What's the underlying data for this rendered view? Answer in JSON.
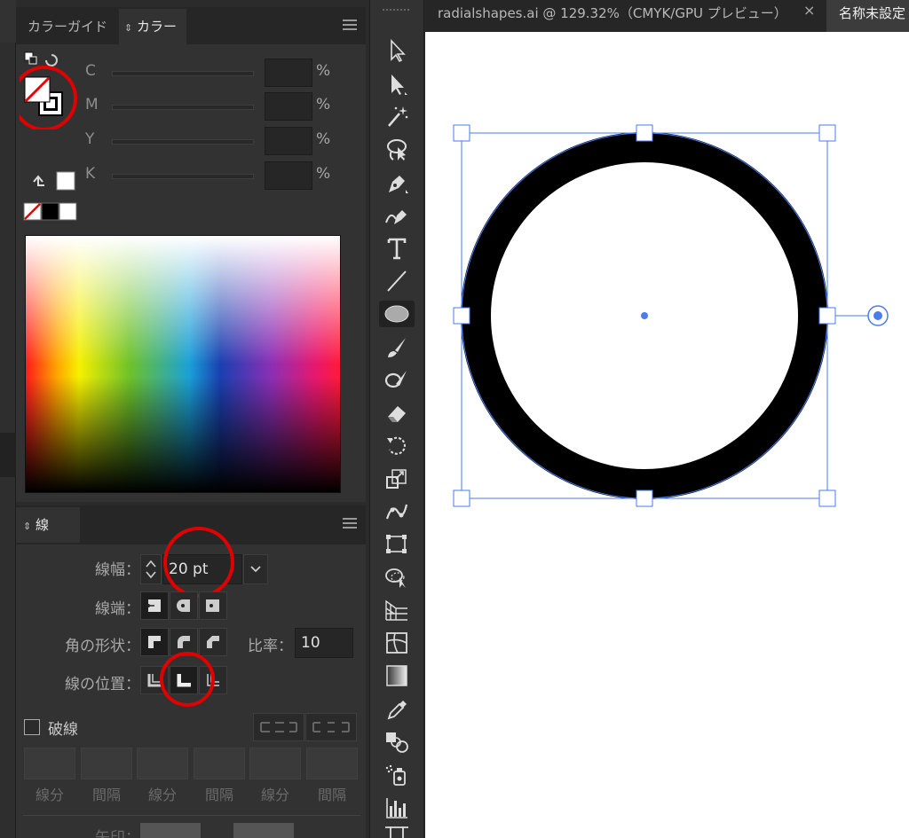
{
  "color_panel": {
    "tabs": [
      {
        "label": "カラーガイド"
      },
      {
        "label": "カラー",
        "active": true
      }
    ],
    "cmyk": [
      {
        "label": "C",
        "value": "",
        "unit": "%"
      },
      {
        "label": "M",
        "value": "",
        "unit": "%"
      },
      {
        "label": "Y",
        "value": "",
        "unit": "%"
      },
      {
        "label": "K",
        "value": "",
        "unit": "%"
      }
    ]
  },
  "stroke_panel": {
    "tab_label": "線",
    "weight_label": "線幅：",
    "weight_value": "20 pt",
    "cap_label": "線端：",
    "join_label": "角の形状：",
    "ratio_label": "比率：",
    "ratio_value": "10",
    "align_label": "線の位置：",
    "dashed_label": "破線",
    "dash_segments": [
      "線分",
      "間隔",
      "線分",
      "間隔",
      "線分",
      "間隔"
    ],
    "arrow_label": "矢印："
  },
  "document": {
    "tabs": [
      {
        "label": "radialshapes.ai  @  129.32%（CMYK/GPU プレビュー）",
        "close": "×"
      },
      {
        "label": "名称未設定"
      }
    ]
  },
  "tools": [
    "selection-tool",
    "direct-selection-tool",
    "magic-wand-tool",
    "lasso-tool",
    "pen-tool",
    "curvature-tool",
    "type-tool",
    "line-tool",
    "ellipse-tool",
    "paintbrush-tool",
    "shaper-tool",
    "eraser-tool",
    "rotate-tool",
    "scale-tool",
    "puppet-warp-tool",
    "free-transform-tool",
    "shape-builder-tool",
    "perspective-grid-tool",
    "mesh-tool",
    "gradient-tool",
    "eyedropper-tool",
    "blend-tool",
    "symbol-sprayer-tool",
    "column-graph-tool",
    "artboard-tool"
  ],
  "colors": {
    "annotation": "#e00000",
    "selection": "#4a7bef",
    "stroke": "#000000"
  }
}
